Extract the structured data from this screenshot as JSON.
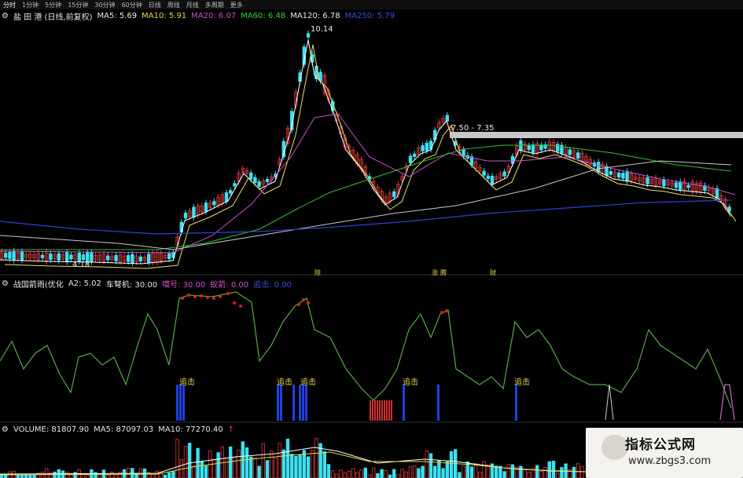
{
  "toolbar": {
    "items": [
      "分时",
      "1分钟",
      "5分钟",
      "15分钟",
      "30分钟",
      "60分钟",
      "日线",
      "周线",
      "月线",
      "多周期",
      "更多"
    ]
  },
  "main_legend": {
    "stock": "盐 田 港 (日线,前复权)",
    "ma5": "MA5: 5.69",
    "ma10": "MA10: 5.91",
    "ma20": "MA20: 6.07",
    "ma60": "MA60: 6.48",
    "ma120": "MA120: 6.78",
    "ma250": "MA250: 5.79"
  },
  "main_annotations": {
    "high": "10.14",
    "low": "4.18",
    "band": "7.50 - 7.35",
    "event_marks": [
      "除",
      "涨",
      "腾",
      "财"
    ]
  },
  "indicator_legend": {
    "name": "战国箭雨(优化",
    "a2": "A2: 5.02",
    "chezhiji": "车弩机: 30.00",
    "haohao": "嚆号: 30.00",
    "xinzhen": "蚁箭: 0.00",
    "other": "追击: 0.00"
  },
  "indicator_labels": [
    "追击",
    "追击",
    "追击",
    "追击",
    "追击"
  ],
  "volume_legend": {
    "name": "VOLUME: 81807.90",
    "ma5": "MA5: 87097.03",
    "ma10": "MA10: 77270.40"
  },
  "watermark": {
    "title": "指标公式网",
    "url": "www.zbgs3.com"
  },
  "colors": {
    "up": "#e03c3c",
    "down": "#3ce0f0",
    "ma5": "#ffffff",
    "ma10": "#f0e060",
    "ma20": "#d050d0",
    "ma60": "#30c030",
    "ma250": "#3040d0",
    "bar_blue": "#2040e0"
  }
}
